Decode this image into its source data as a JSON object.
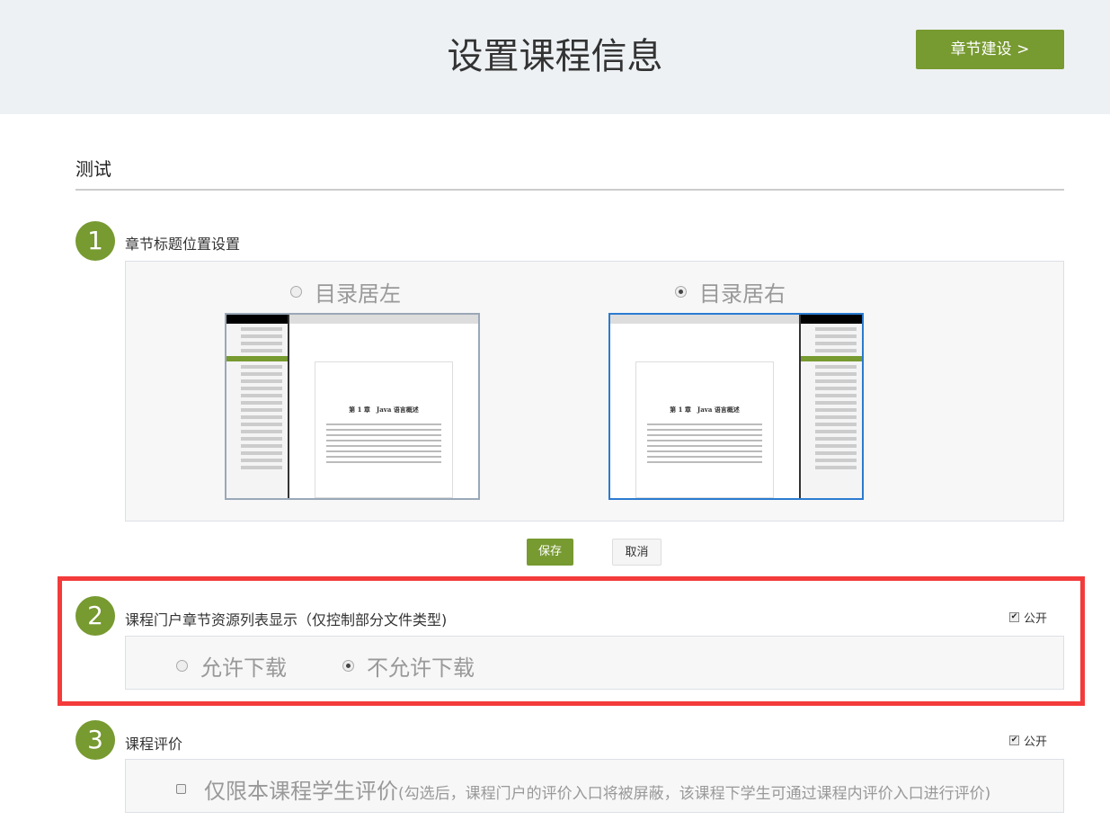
{
  "header": {
    "title": "设置课程信息",
    "next_button": "章节建设 >"
  },
  "course_name": "测试",
  "sections": [
    {
      "number": "1",
      "title": "章节标题位置设置",
      "options": [
        {
          "label": "目录居左",
          "selected": false
        },
        {
          "label": "目录居右",
          "selected": true
        }
      ],
      "preview_chapter_title": "第 1 章　Java 语言概述",
      "save": "保存",
      "cancel": "取消"
    },
    {
      "number": "2",
      "title": "课程门户章节资源列表显示（仅控制部分文件类型)",
      "public_label": "公开",
      "public_checked": true,
      "options": [
        {
          "label": "允许下载",
          "selected": false
        },
        {
          "label": "不允许下载",
          "selected": true
        }
      ]
    },
    {
      "number": "3",
      "title": "课程评价",
      "public_label": "公开",
      "public_checked": true,
      "option_label": "仅限本课程学生评价",
      "option_note": "(勾选后，课程门户的评价入口将被屏蔽，该课程下学生可通过课程内评价入口进行评价)",
      "option_checked": false
    }
  ],
  "colors": {
    "accent": "#779a31",
    "highlight": "#f33b3b"
  }
}
